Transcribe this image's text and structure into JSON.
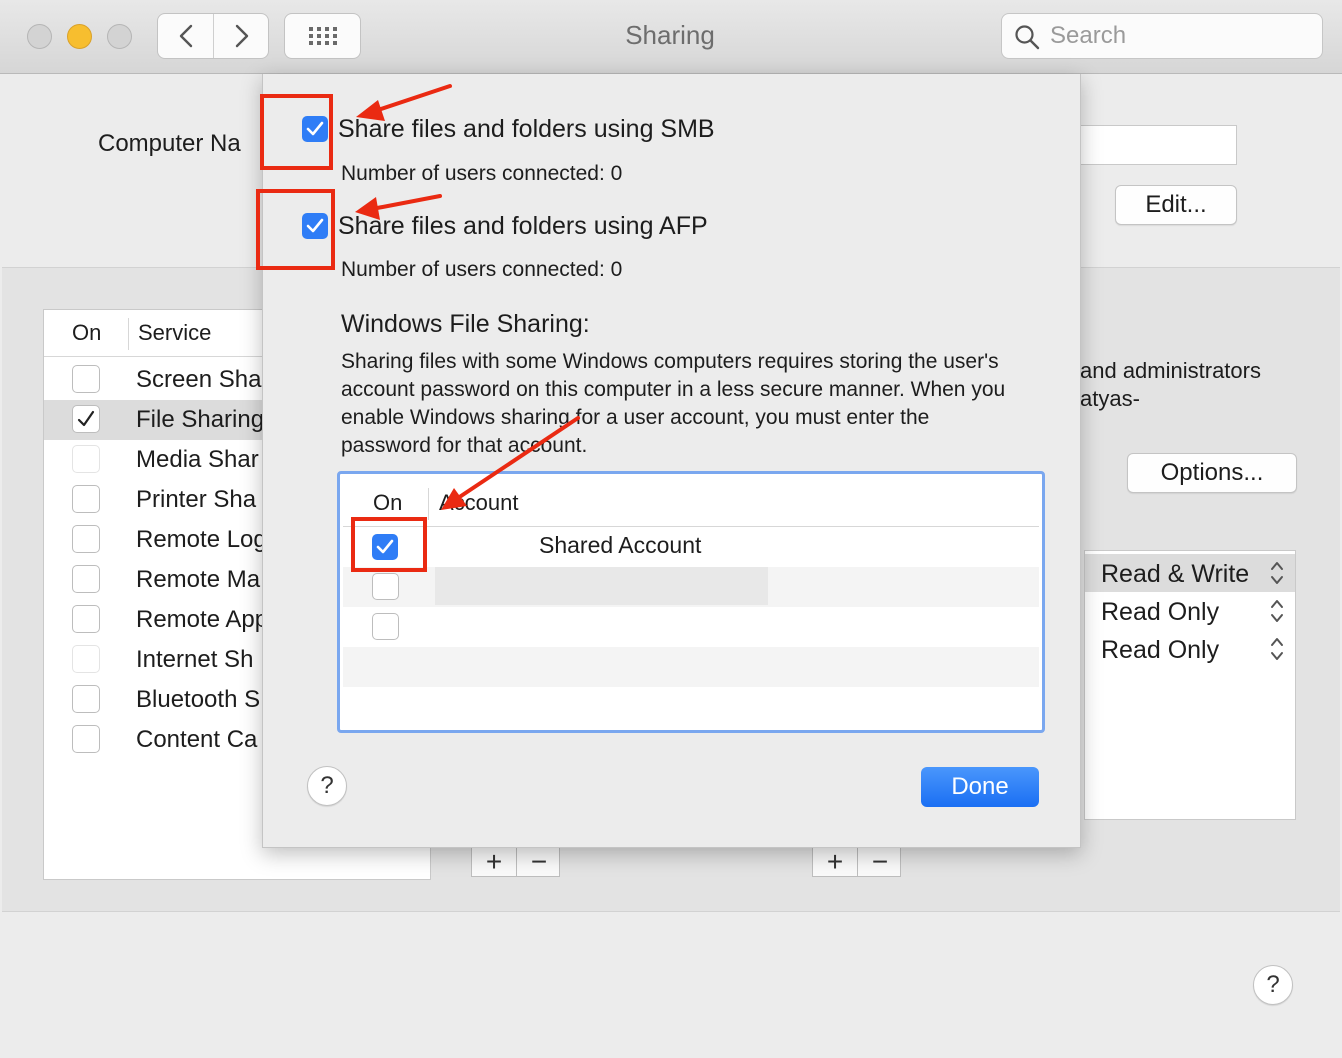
{
  "window": {
    "title": "Sharing",
    "search_placeholder": "Search"
  },
  "background": {
    "computer_name_label": "Computer Na",
    "edit_button": "Edit...",
    "options_button": "Options...",
    "description_lines": [
      "and administrators",
      "atyas-"
    ],
    "service_list": {
      "header_on": "On",
      "header_service": "Service",
      "items": [
        {
          "label": "Screen Sha",
          "checked": false,
          "selected": false
        },
        {
          "label": "File Sharing",
          "checked": true,
          "selected": true
        },
        {
          "label": "Media Shar",
          "checked": false,
          "selected": false
        },
        {
          "label": "Printer Sha",
          "checked": false,
          "selected": false
        },
        {
          "label": "Remote Log",
          "checked": false,
          "selected": false
        },
        {
          "label": "Remote Ma",
          "checked": false,
          "selected": false
        },
        {
          "label": "Remote App",
          "checked": false,
          "selected": false
        },
        {
          "label": "Internet Sh",
          "checked": false,
          "selected": false
        },
        {
          "label": "Bluetooth S",
          "checked": false,
          "selected": false
        },
        {
          "label": "Content Ca",
          "checked": false,
          "selected": false
        }
      ]
    },
    "permissions": [
      "Read & Write",
      "Read Only",
      "Read Only"
    ],
    "add_symbol": "+",
    "remove_symbol": "−",
    "help_symbol": "?"
  },
  "sheet": {
    "smb": {
      "label": "Share files and folders using SMB",
      "checked": true,
      "users": "Number of users connected: 0"
    },
    "afp": {
      "label": "Share files and folders using AFP",
      "checked": true,
      "users": "Number of users connected: 0"
    },
    "windows_title": "Windows File Sharing:",
    "windows_desc": "Sharing files with some Windows computers requires storing the user's account password on this computer in a less secure manner. When you enable Windows sharing for a user account, you must enter the password for that account.",
    "table": {
      "header_on": "On",
      "header_account": "Account",
      "rows": [
        {
          "account": "Shared Account",
          "checked": true
        },
        {
          "account": "",
          "checked": false
        },
        {
          "account": "",
          "checked": false
        }
      ]
    },
    "help_symbol": "?",
    "done_button": "Done"
  },
  "colors": {
    "accent_blue": "#2f7df6",
    "annotation_red": "#ea2a12",
    "traffic_yellow": "#f7be2f"
  }
}
